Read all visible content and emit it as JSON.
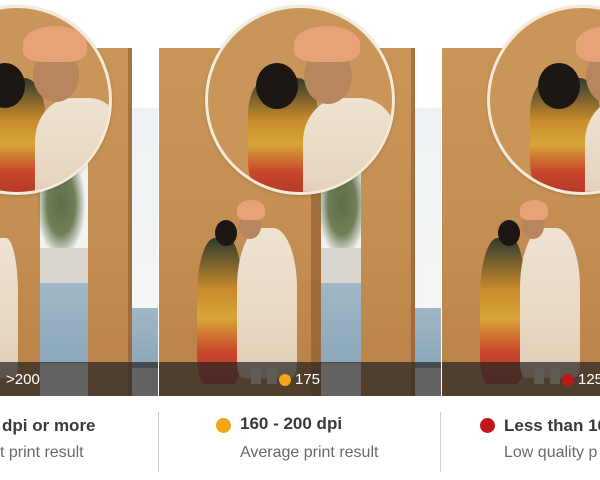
{
  "panels": [
    {
      "id": "left",
      "indicator": ">200",
      "dot_color": ""
    },
    {
      "id": "middle",
      "indicator": "175",
      "dot_color": "#f2a619"
    },
    {
      "id": "right",
      "indicator": "125",
      "dot_color": "#c0171b"
    }
  ],
  "legend": [
    {
      "title": "dpi or more",
      "subtitle": "t print result",
      "dot_color": ""
    },
    {
      "title": "160 - 200 dpi",
      "subtitle": "Average print result",
      "dot_color": "#f2a619"
    },
    {
      "title": "Less than 160",
      "subtitle": "Low quality p",
      "dot_color": "#c0171b"
    }
  ],
  "colors": {
    "info_bar": "#2b2826",
    "zoom_ring": "#f4ead8",
    "wall": "#c99558"
  }
}
